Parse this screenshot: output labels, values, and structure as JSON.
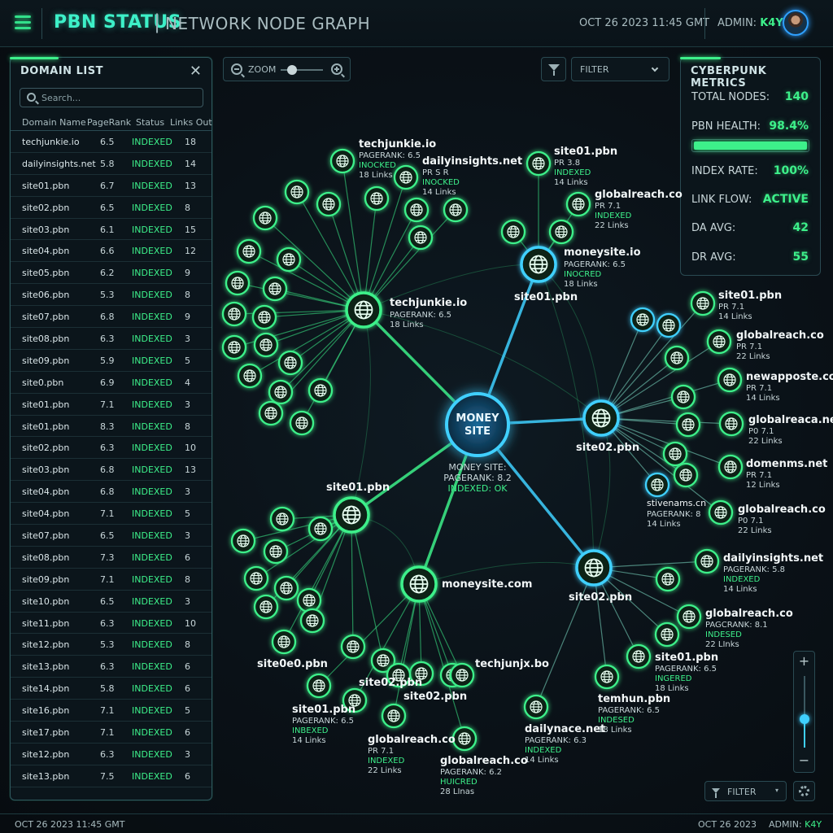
{
  "header": {
    "title": "PBN STATUS",
    "separator": "|",
    "subtitle": "NETWORK NODE GRAPH",
    "datetime": "OCT 26 2023 11:45 GMT",
    "admin_label": "ADMIN:",
    "admin_user": "K4Y"
  },
  "domain_list": {
    "title": "DOMAIN LIST",
    "search_placeholder": "Search...",
    "columns": [
      "Domain Name",
      "PageRank",
      "Status",
      "Links Out"
    ],
    "rows": [
      [
        "techjunkie.io",
        "6.5",
        "INDEXED",
        "18"
      ],
      [
        "dailyinsights.net",
        "5.8",
        "INDEXED",
        "14"
      ],
      [
        "site01.pbn",
        "6.7",
        "INDEXED",
        "13"
      ],
      [
        "site02.pbn",
        "6.5",
        "INDEXED",
        "8"
      ],
      [
        "site03.pbn",
        "6.1",
        "INDEXED",
        "15"
      ],
      [
        "site04.pbn",
        "6.6",
        "INDEXED",
        "12"
      ],
      [
        "site05.pbn",
        "6.2",
        "INDEXED",
        "9"
      ],
      [
        "site06.pbn",
        "5.3",
        "INDEXED",
        "8"
      ],
      [
        "site07.pbn",
        "6.8",
        "INDEXED",
        "9"
      ],
      [
        "site08.pbn",
        "6.3",
        "INDEXED",
        "3"
      ],
      [
        "site09.pbn",
        "5.9",
        "INDEXED",
        "5"
      ],
      [
        "site0.pbn",
        "6.9",
        "INDEXED",
        "4"
      ],
      [
        "site01.pbn",
        "7.1",
        "INDEXED",
        "3"
      ],
      [
        "site01.pbn",
        "8.3",
        "INDEXED",
        "8"
      ],
      [
        "site02.pbn",
        "6.3",
        "INDEXED",
        "10"
      ],
      [
        "site03.pbn",
        "6.8",
        "INDEXED",
        "13"
      ],
      [
        "site04.pbn",
        "6.8",
        "INDEXED",
        "3"
      ],
      [
        "site04.pbn",
        "7.1",
        "INDEXED",
        "5"
      ],
      [
        "site07.pbn",
        "6.5",
        "INDEXED",
        "3"
      ],
      [
        "site08.pbn",
        "7.3",
        "INDEXED",
        "6"
      ],
      [
        "site09.pbn",
        "7.1",
        "INDEXED",
        "8"
      ],
      [
        "site10.pbn",
        "6.5",
        "INDEXED",
        "3"
      ],
      [
        "site11.pbn",
        "6.3",
        "INDEXED",
        "10"
      ],
      [
        "site12.pbn",
        "5.3",
        "INDEXED",
        "8"
      ],
      [
        "site13.pbn",
        "6.3",
        "INDEXED",
        "6"
      ],
      [
        "site14.pbn",
        "5.8",
        "INDEXED",
        "6"
      ],
      [
        "site16.pbn",
        "7.1",
        "INDEXED",
        "5"
      ],
      [
        "site17.pbn",
        "7.1",
        "INDEXED",
        "6"
      ],
      [
        "site12.pbn",
        "6.3",
        "INDEXED",
        "3"
      ],
      [
        "site13.pbn",
        "7.5",
        "INDEXED",
        "6"
      ]
    ]
  },
  "toolbar": {
    "zoom_label": "ZOOM",
    "zoom_level": 0.15,
    "filter_label": "FILTER"
  },
  "metrics": {
    "title": "CYBERPUNK METRICS",
    "total_nodes_label": "TOTAL NODES:",
    "total_nodes": "140",
    "health_label": "PBN HEALTH:",
    "health": "98.4%",
    "health_fraction": 0.984,
    "index_rate_label": "INDEX RATE:",
    "index_rate": "100%",
    "link_flow_label": "LINK FLOW:",
    "link_flow": "ACTIVE",
    "da_label": "DA AVG:",
    "da": "42",
    "dr_label": "DR AVG:",
    "dr": "55"
  },
  "graph": {
    "center": {
      "label": "MONEY\nSITE",
      "info": [
        "MONEY SITE:",
        "PAGERANK: 8.2",
        "INDEXED: OK"
      ]
    },
    "hubs": [
      {
        "name": "techjunkie.io",
        "lines": [
          "PAGERANK: 6.5",
          "18 Links"
        ]
      },
      {
        "name": "moneysite.io",
        "lines": [
          "PAGERANK: 6.5",
          "INOCRED",
          "18 Links"
        ],
        "sub": "site01.pbn"
      },
      {
        "name": "site02.pbn",
        "lines": []
      },
      {
        "name": "site01.pbn",
        "lines": []
      },
      {
        "name": "moneysite.com",
        "lines": []
      },
      {
        "name": "site02.pbn",
        "lines": []
      }
    ],
    "labels": [
      {
        "name": "techjunkie.io",
        "lines": [
          "PAGERANK: 6.5",
          "INOCKED",
          "18 Links"
        ]
      },
      {
        "name": "dailyinsights.net",
        "lines": [
          "PR S R",
          "INOCKED",
          "14 Links"
        ]
      },
      {
        "name": "site01.pbn",
        "lines": [
          "PR 3.8",
          "INDEXED",
          "14 Links"
        ]
      },
      {
        "name": "globalreach.co",
        "lines": [
          "PR 7.1",
          "INDEXED",
          "22 Links"
        ]
      },
      {
        "name": "site01.pbn",
        "lines": [
          "PR 7.1",
          "14 Links"
        ]
      },
      {
        "name": "globalreach.co",
        "lines": [
          "PR 7.1",
          "22 Links"
        ]
      },
      {
        "name": "newapposte.co",
        "lines": [
          "PR 7.1",
          "14 Links"
        ]
      },
      {
        "name": "globalreaca.net",
        "lines": [
          "P0 7.1",
          "22 Links"
        ]
      },
      {
        "name": "domenms.net",
        "lines": [
          "PR 7.1",
          "12 Links"
        ]
      },
      {
        "name": "stivenams.cn",
        "lines": [
          "PAGERANK: 8",
          "14 Links"
        ]
      },
      {
        "name": "globalreach.co",
        "lines": [
          "P0 7.1",
          "22 Links"
        ]
      },
      {
        "name": "dailyinsights.net",
        "lines": [
          "PAGERANK: 5.8",
          "INDEXED",
          "14 Links"
        ]
      },
      {
        "name": "globalreach.co",
        "lines": [
          "PAGCRANK: 8.1",
          "INDESED",
          "22 LInks"
        ]
      },
      {
        "name": "site01.pbn",
        "lines": [
          "PAGERANK: 6.5",
          "INGERED",
          "18 Links"
        ]
      },
      {
        "name": "temhun.pbn",
        "lines": [
          "PAGERANK: 6.5",
          "INDESED",
          "18 Links"
        ]
      },
      {
        "name": "dailynace.net",
        "lines": [
          "PAGERANK: 6.3",
          "INDEXED",
          "14 Links"
        ]
      },
      {
        "name": "globalreach.co",
        "lines": [
          "PAGERANK: 6.2",
          "HUICRED",
          "28 LInas"
        ]
      },
      {
        "name": "globalreach.co",
        "lines": [
          "PR 7.1",
          "INDEXED",
          "22 Links"
        ]
      },
      {
        "name": "site01.pbn",
        "lines": [
          "PAGERANK: 6.5",
          "INBEXED",
          "14 Links"
        ]
      },
      {
        "name": "site0e0.pbn",
        "lines": []
      },
      {
        "name": "site02.pbn",
        "lines": []
      },
      {
        "name": "site02.pbn",
        "lines": []
      },
      {
        "name": "techjunjx.bo",
        "lines": []
      }
    ]
  },
  "zoom_control": {
    "plus": "+",
    "minus": "−",
    "level": 0.4
  },
  "bottom_filter_label": "FILTER",
  "footer": {
    "datetime": "OCT 26 2023 11:45 GMT",
    "date": "OCT 26 2023",
    "admin_label": "ADMIN:",
    "admin_user": "K4Y"
  },
  "colors": {
    "accent_green": "#3df08a",
    "accent_cyan": "#3fd0ff",
    "background": "#0a1117"
  },
  "icons": [
    "hamburger-icon",
    "close-icon",
    "search-icon",
    "zoom-out-icon",
    "zoom-in-icon",
    "filter-icon",
    "chevron-down-icon",
    "globe-icon",
    "gear-icon"
  ]
}
